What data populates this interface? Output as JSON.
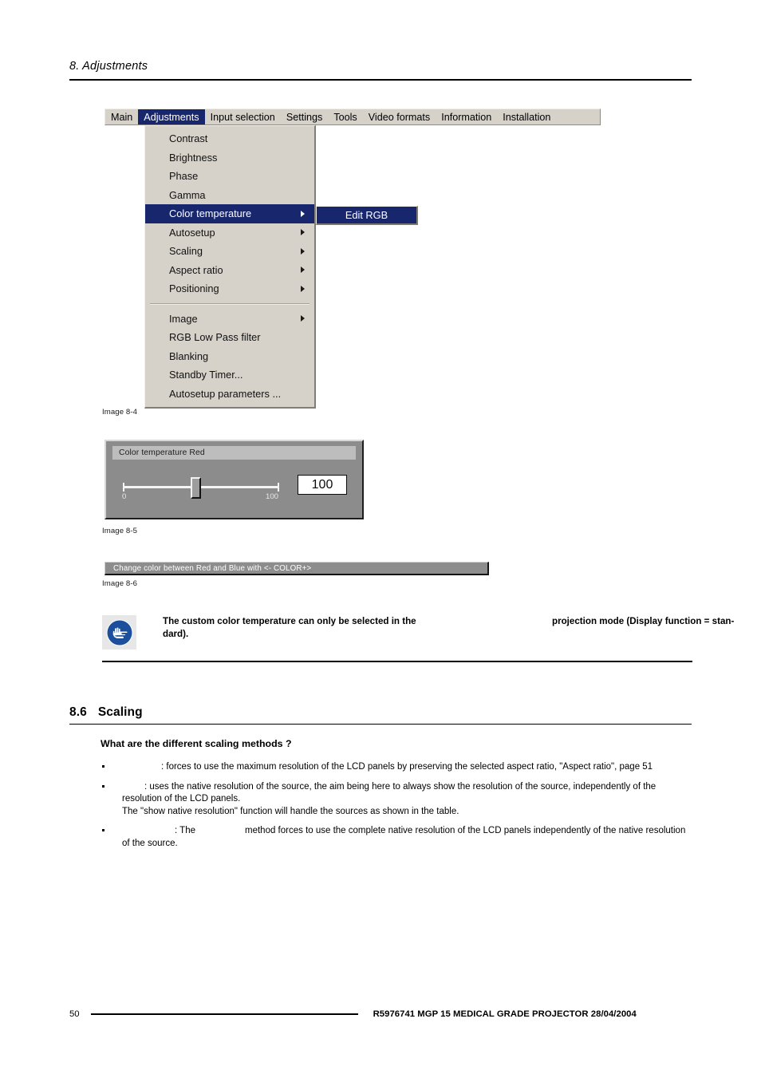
{
  "page": {
    "running_header": "8.  Adjustments",
    "footer_page_number": "50",
    "footer_text": "R5976741   MGP 15 MEDICAL GRADE PROJECTOR  28/04/2004"
  },
  "osd_menu": {
    "menubar": [
      {
        "label": "Main",
        "active": false
      },
      {
        "label": "Adjustments",
        "active": true
      },
      {
        "label": "Input selection",
        "active": false
      },
      {
        "label": "Settings",
        "active": false
      },
      {
        "label": "Tools",
        "active": false
      },
      {
        "label": "Video formats",
        "active": false
      },
      {
        "label": "Information",
        "active": false
      },
      {
        "label": "Installation",
        "active": false
      }
    ],
    "dropdown_items": [
      {
        "label": "Contrast",
        "submenu": false,
        "highlight": false
      },
      {
        "label": "Brightness",
        "submenu": false,
        "highlight": false
      },
      {
        "label": "Phase",
        "submenu": false,
        "highlight": false
      },
      {
        "label": "Gamma",
        "submenu": false,
        "highlight": false
      },
      {
        "label": "Color temperature",
        "submenu": true,
        "highlight": true
      },
      {
        "label": "Autosetup",
        "submenu": true,
        "highlight": false
      },
      {
        "label": "Scaling",
        "submenu": true,
        "highlight": false
      },
      {
        "label": "Aspect ratio",
        "submenu": true,
        "highlight": false
      },
      {
        "label": "Positioning",
        "submenu": true,
        "highlight": false
      },
      {
        "separator": true
      },
      {
        "label": "Image",
        "submenu": true,
        "highlight": false
      },
      {
        "label": "RGB Low Pass filter",
        "submenu": false,
        "highlight": false
      },
      {
        "label": "Blanking",
        "submenu": false,
        "highlight": false
      },
      {
        "label": "Standby Timer...",
        "submenu": false,
        "highlight": false
      },
      {
        "label": "Autosetup parameters ...",
        "submenu": false,
        "highlight": false
      }
    ],
    "submenu_label": "Edit RGB",
    "caption": "Image 8-4",
    "highlight_color": "#18276d",
    "face_color": "#d6d2ca"
  },
  "slider_dialog": {
    "title": "Color temperature Red",
    "min_label": "0",
    "max_label": "100",
    "value": "100",
    "caption": "Image 8-5"
  },
  "info_bar": {
    "text": "Change color between Red and Blue with <- COLOR+>",
    "caption": "Image 8-6"
  },
  "note": {
    "icon": "pointing-hand-icon",
    "text_left": "The custom color temperature can only be selected in the",
    "text_right": "projection mode (Display function = stan-",
    "text_second_line": "dard)."
  },
  "section": {
    "number": "8.6",
    "title": "Scaling",
    "subheading": "What are the different scaling methods ?",
    "bullets": [
      {
        "lead_blank": "w1",
        "text": ": forces to use the maximum resolution of the LCD panels by preserving the selected aspect ratio, \"Aspect ratio\", page 51"
      },
      {
        "lead_blank": "w2",
        "text": ": uses the native resolution of the source, the aim being here to always show the resolution of the source, independently of the resolution of the LCD panels.",
        "extra_line": "The \"show native resolution\" function will handle the sources as shown in the table."
      },
      {
        "lead_blank": "w3",
        "text_before": ": The",
        "mid_blank": "w4",
        "text_after": "method forces to use the complete native resolution of the LCD panels independently of the native resolution of the source."
      }
    ]
  }
}
